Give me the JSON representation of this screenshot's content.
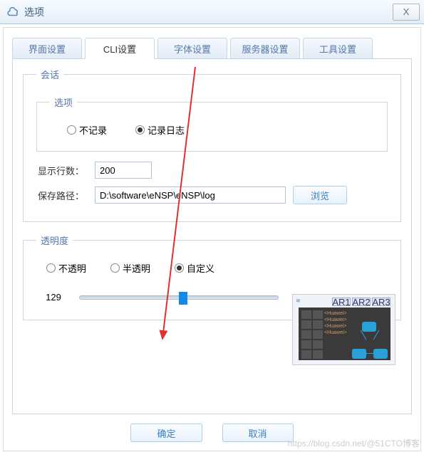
{
  "window": {
    "title": "选项",
    "close": "X"
  },
  "tabs": {
    "items": [
      {
        "label": "界面设置"
      },
      {
        "label": "CLI设置"
      },
      {
        "label": "字体设置"
      },
      {
        "label": "服务器设置"
      },
      {
        "label": "工具设置"
      }
    ],
    "activeIndex": 1
  },
  "session": {
    "legend": "会话",
    "options_legend": "选项",
    "no_record": "不记录",
    "record_log": "记录日志",
    "record_selected": "record_log",
    "rows_label": "显示行数：",
    "rows_value": "200",
    "path_label": "保存路径：",
    "path_value": "D:\\software\\eNSP\\eNSP\\log",
    "browse": "浏览"
  },
  "transparency": {
    "legend": "透明度",
    "opaque": "不透明",
    "semi": "半透明",
    "custom": "自定义",
    "selected": "custom",
    "value": 129,
    "min": 0,
    "max": 255
  },
  "preview_tabs": [
    "AR1",
    "AR2",
    "AR3"
  ],
  "footer": {
    "ok": "确定",
    "cancel": "取消"
  },
  "watermark": "https://blog.csdn.net/@51CTO博客"
}
